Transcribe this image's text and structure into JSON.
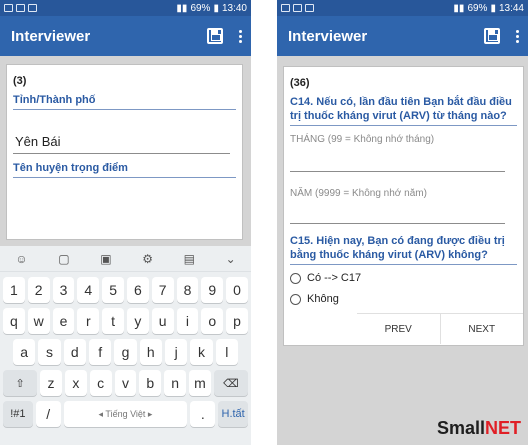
{
  "left": {
    "status": {
      "percent": "69%",
      "time": "13:40"
    },
    "appbar": {
      "title": "Interviewer",
      "save_icon": "save-icon",
      "menu_icon": "more-vert-icon"
    },
    "question": {
      "number": "(3)",
      "label1": "Tỉnh/Thành phố",
      "value1": "Yên Bái",
      "label2": "Tên huyện trọng điểm"
    },
    "keyboard": {
      "tool_icons": [
        "emoji-icon",
        "sticker-icon",
        "gif-icon",
        "settings-icon",
        "clipboard-icon",
        "chevron-down-icon"
      ],
      "row_numbers": [
        "1",
        "2",
        "3",
        "4",
        "5",
        "6",
        "7",
        "8",
        "9",
        "0"
      ],
      "row_top": [
        "q",
        "w",
        "e",
        "r",
        "t",
        "y",
        "u",
        "i",
        "o",
        "p"
      ],
      "row_mid": [
        "a",
        "s",
        "d",
        "f",
        "g",
        "h",
        "j",
        "k",
        "l"
      ],
      "row_bottom": [
        "z",
        "x",
        "c",
        "v",
        "b",
        "n",
        "m"
      ],
      "shift": "⇧",
      "backspace": "⌫",
      "symbols": "!#1",
      "slash": "/",
      "space": "◂ Tiếng Việt ▸",
      "period": ".",
      "done": "H.tất"
    }
  },
  "right": {
    "status": {
      "percent": "69%",
      "time": "13:44"
    },
    "appbar": {
      "title": "Interviewer",
      "save_icon": "save-icon",
      "menu_icon": "more-vert-icon"
    },
    "question": {
      "number": "(36)",
      "c14_label": "C14. Nếu có, lần đầu tiên Bạn bắt đầu điều trị thuốc kháng virut (ARV) từ tháng nào?",
      "month_hint": "THÁNG (99 = Không nhớ tháng)",
      "year_hint": "NĂM (9999 = Không nhớ năm)",
      "c15_label": "C15. Hiện nay, Bạn có đang được điều trị bằng thuốc kháng virut (ARV) không?",
      "option_yes": "Có   --> C17",
      "option_no": "Không"
    },
    "nav": {
      "prev": "PREV",
      "next": "NEXT"
    }
  },
  "logo": {
    "part1": "Small",
    "part2": "NET"
  }
}
